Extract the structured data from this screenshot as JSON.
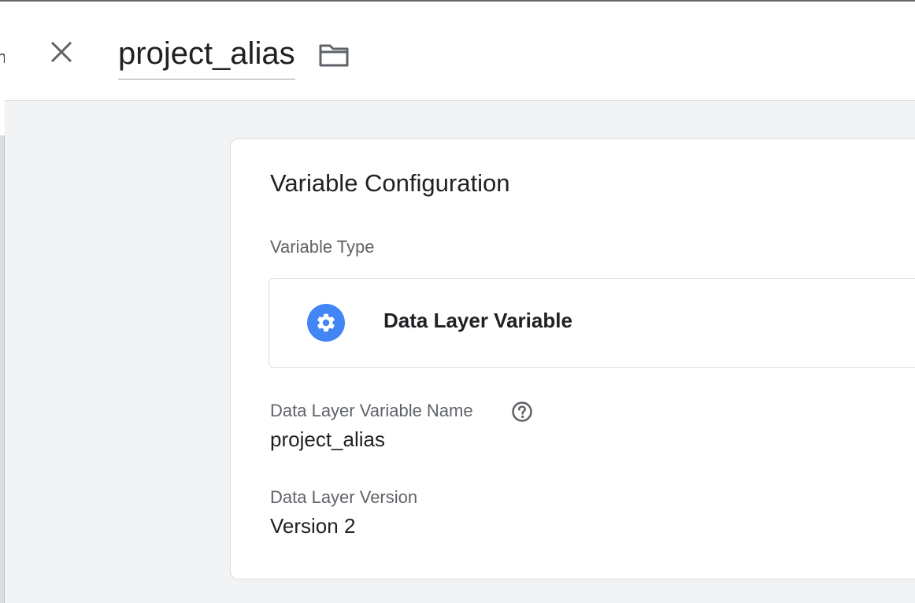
{
  "header": {
    "title": "project_alias",
    "close_icon": "close-icon",
    "folder_icon": "folder-icon"
  },
  "left_edge": {
    "glyph": "n"
  },
  "card": {
    "title": "Variable Configuration",
    "variable_type": {
      "label": "Variable Type",
      "value": "Data Layer Variable",
      "icon": "gear-icon",
      "icon_color": "#4285f4"
    },
    "name_field": {
      "label": "Data Layer Variable Name",
      "value": "project_alias",
      "help_icon": "help-icon"
    },
    "version_field": {
      "label": "Data Layer Version",
      "value": "Version 2"
    }
  }
}
